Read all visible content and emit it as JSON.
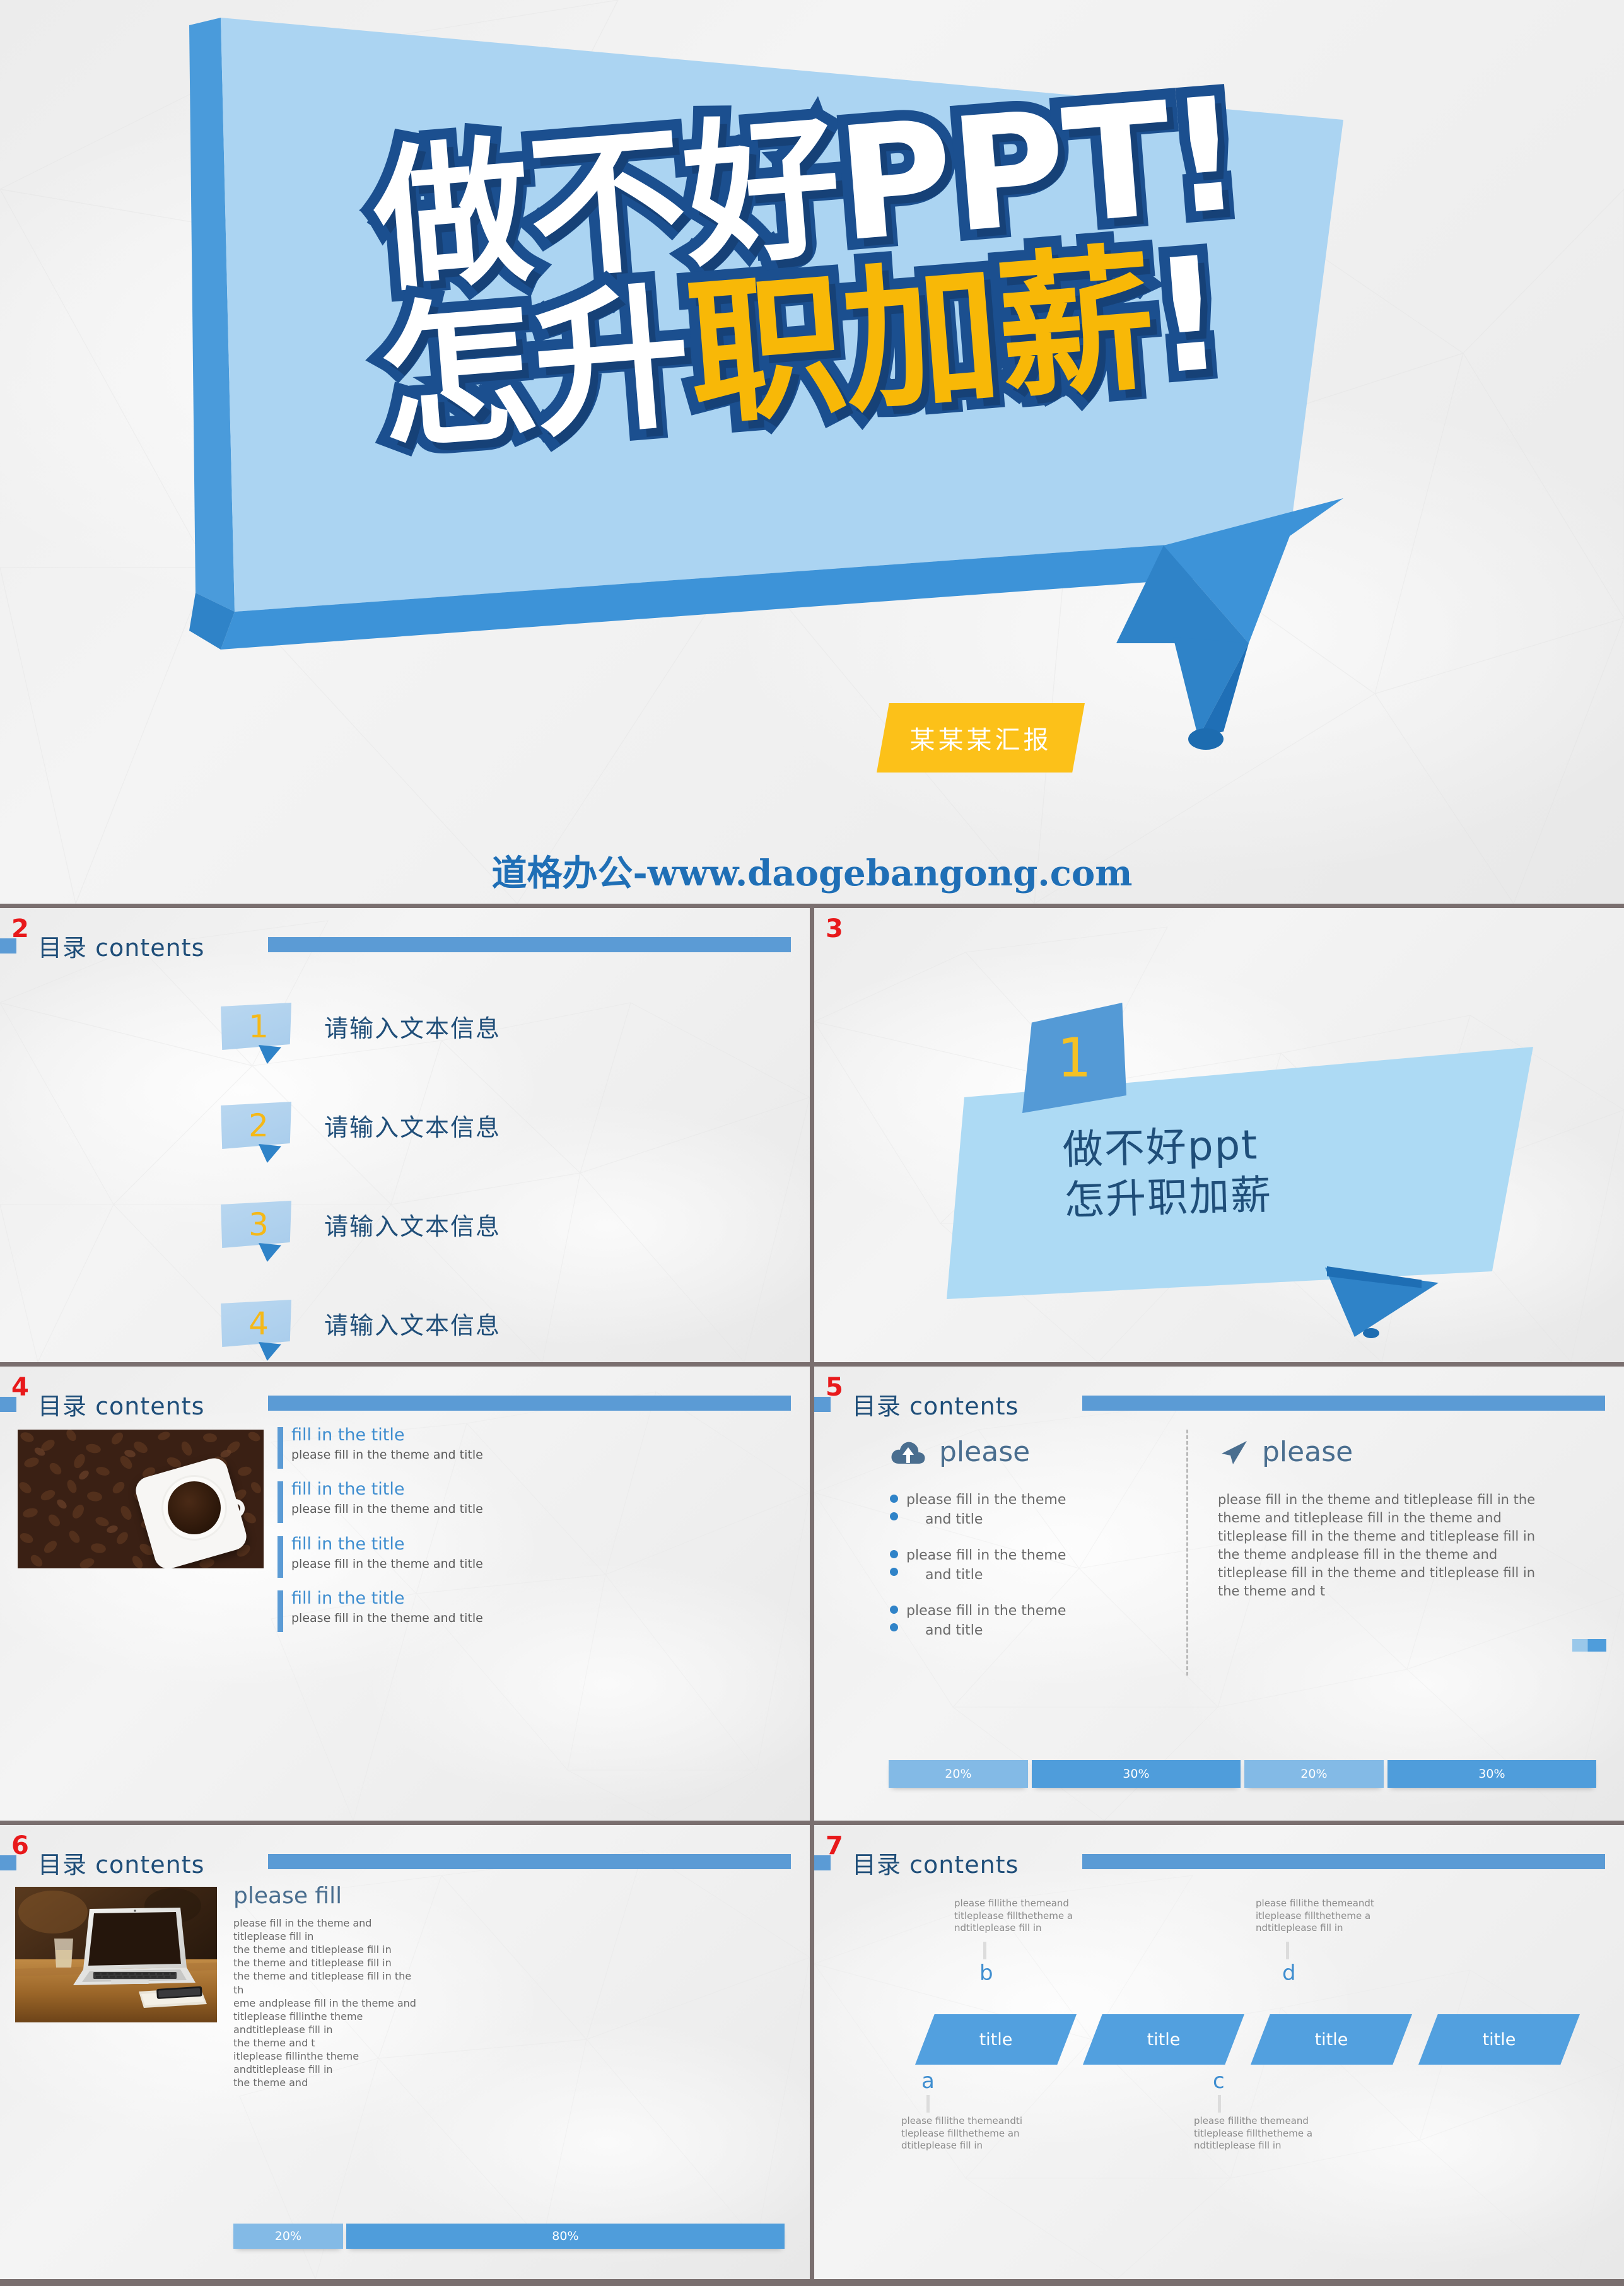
{
  "theme": {
    "accent_blue": "#5b9bd5",
    "dark_blue": "#1f4e79",
    "light_blue": "#addaf4",
    "yellow": "#fcc119",
    "red": "#e8191b",
    "gray_text": "#6a6a6a"
  },
  "slide1": {
    "page": "1",
    "title_line1": "做不好PPT!",
    "title_line2_white": "怎升",
    "title_line2_yellow": "职加薪",
    "title_line2_excl": "!",
    "subtitle_tag": "某某某汇报",
    "website": "道格办公-www.daogebangong.com"
  },
  "slide2": {
    "page": "2",
    "header": "目录 contents",
    "items": [
      {
        "num": "1",
        "label": "请输入文本信息"
      },
      {
        "num": "2",
        "label": "请输入文本信息"
      },
      {
        "num": "3",
        "label": "请输入文本信息"
      },
      {
        "num": "4",
        "label": "请输入文本信息"
      }
    ]
  },
  "slide3": {
    "page": "3",
    "section_num": "1",
    "text_line1": "做不好ppt",
    "text_line2": "怎升职加薪"
  },
  "slide4": {
    "page": "4",
    "header": "目录 contents",
    "image_alt": "coffee-cup-on-beans",
    "items": [
      {
        "title": "fill in the title",
        "body": "please fill in the theme and title"
      },
      {
        "title": "fill in the title",
        "body": "please fill in the theme and title"
      },
      {
        "title": "fill in the title",
        "body": "please fill in the theme and title"
      },
      {
        "title": "fill in the title",
        "body": "please fill in the theme and title"
      }
    ]
  },
  "slide5": {
    "page": "5",
    "header": "目录 contents",
    "left": {
      "icon": "cloud-upload-icon",
      "title": "please",
      "bullets": [
        {
          "line1": "please fill in the theme",
          "line2": "and title"
        },
        {
          "line1": "please fill in the theme",
          "line2": "and title"
        },
        {
          "line1": "please fill in the theme",
          "line2": "and title"
        }
      ]
    },
    "right": {
      "icon": "navigation-arrow-icon",
      "title": "please",
      "paragraph": "please fill in the theme and titleplease fill in the theme and titleplease fill in the theme and titleplease fill in the theme and titleplease fill in the theme andplease fill in the theme and titleplease fill in the theme and titleplease fill in the theme and t"
    },
    "bars": [
      {
        "label": "20%",
        "tone": "light"
      },
      {
        "label": "30%",
        "tone": "dark"
      },
      {
        "label": "20%",
        "tone": "light"
      },
      {
        "label": "30%",
        "tone": "dark"
      }
    ]
  },
  "slide6": {
    "page": "6",
    "header": "目录 contents",
    "image_alt": "laptop-on-desk",
    "title": "please fill",
    "paragraph": "please fill in the theme and titleplease fill in\nthe theme and titleplease fill in\nthe theme and titleplease fill in\nthe theme and titleplease fill in the th\neme andplease fill in the theme and\ntitleplease fillinthe theme andtitleplease fill in\nthe theme and t\nitleplease fillinthe theme andtitleplease fill in\nthe theme and",
    "bars": [
      {
        "label": "20%",
        "tone": "light"
      },
      {
        "label": "80%",
        "tone": "dark"
      }
    ]
  },
  "slide7": {
    "page": "7",
    "header": "目录 contents",
    "chevrons": [
      {
        "label": "title"
      },
      {
        "label": "title"
      },
      {
        "label": "title"
      },
      {
        "label": "title"
      }
    ],
    "letters": {
      "a": "a",
      "b": "b",
      "c": "c",
      "d": "d"
    },
    "notes": {
      "b": "please fillithe themeand titleplease fillthetheme a ndtitleplease fill in",
      "d": "please fillithe themeandt itleplease fillthetheme a ndtitleplease fill in",
      "a": "please fillithe themeandti tleplease fillthetheme an dtitleplease fill in",
      "c": "please fillithe themeand titleplease fillthetheme a ndtitleplease fill in"
    }
  }
}
